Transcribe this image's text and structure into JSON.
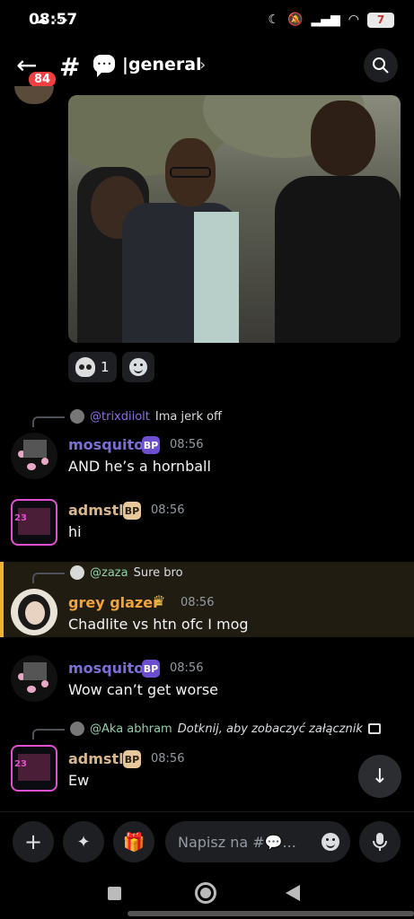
{
  "status": {
    "time": "08:57",
    "battery": "7"
  },
  "header": {
    "unread_badge": "84",
    "channel_name": "general",
    "channel_emoji": "speech-bubble"
  },
  "gif_message": {
    "reactions": [
      {
        "emoji": "skull",
        "count": "1"
      }
    ]
  },
  "messages": [
    {
      "reply_to": "@trixdiiolt",
      "reply_text": "Ima jerk off",
      "author": "mosquito",
      "author_color": "#7b6fd6",
      "badge": "BP",
      "time": "08:56",
      "text": "AND he’s a hornball"
    },
    {
      "author": "admstl",
      "author_color": "#d8b88a",
      "badge": "BP",
      "time": "08:56",
      "text": "hi"
    },
    {
      "reply_to": "@zaza",
      "reply_text": "Sure bro",
      "author": "grey glazer",
      "author_color": "#f0a43a",
      "time": "08:56",
      "text": "Chadlite vs htn ofc I mog",
      "highlighted": true
    },
    {
      "author": "mosquito",
      "author_color": "#7b6fd6",
      "badge": "BP",
      "time": "08:56",
      "text": "Wow can’t get worse"
    },
    {
      "reply_to": "@Aka abhram",
      "reply_text": "Dotknij, aby zobaczyć załącznik",
      "author": "admstl",
      "author_color": "#d8b88a",
      "badge": "BP",
      "time": "08:56",
      "text": "Ew"
    }
  ],
  "input": {
    "placeholder": "Napisz na #💬..."
  },
  "colors": {
    "background": "#000000",
    "mention_purple": "#8e6ee6",
    "highlight_bar": "#f0b232"
  }
}
